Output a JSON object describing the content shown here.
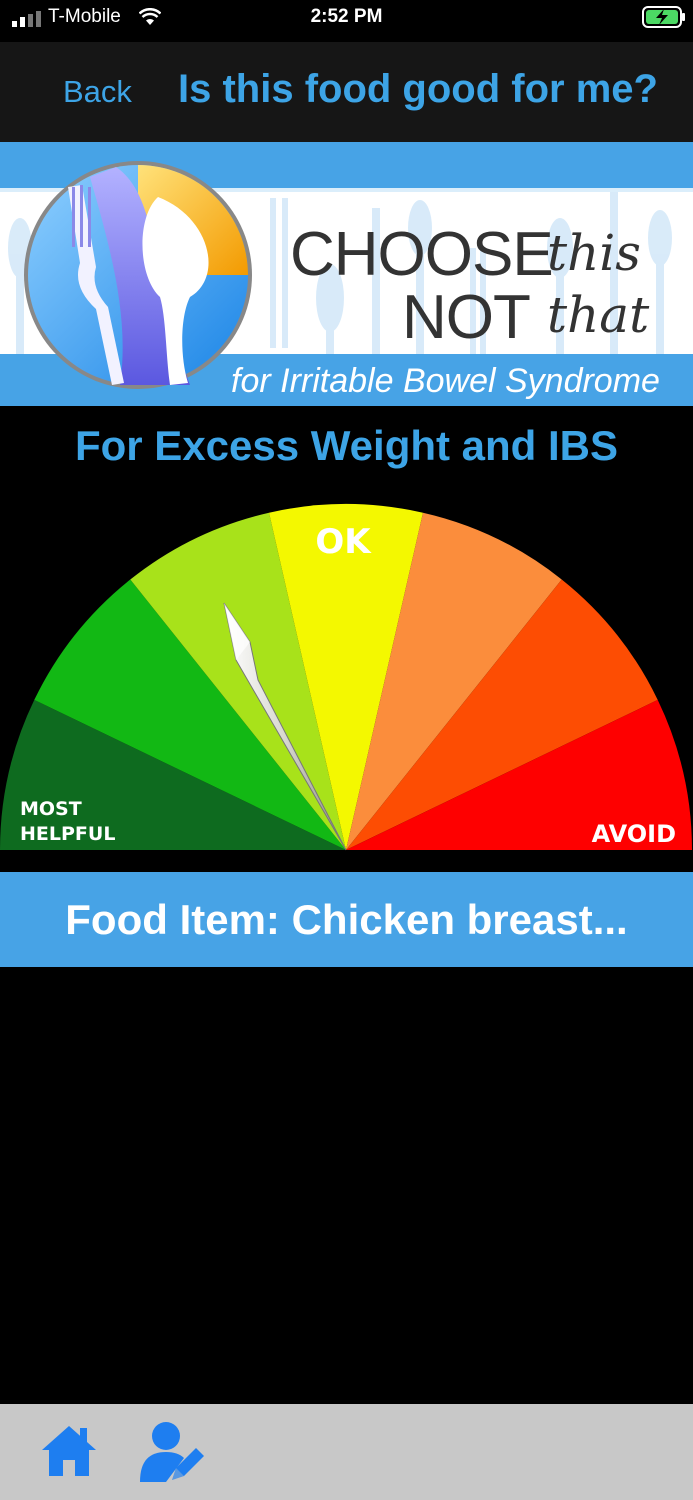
{
  "status_bar": {
    "carrier": "T-Mobile",
    "time": "2:52 PM",
    "icons": [
      "signal-icon",
      "wifi-icon",
      "battery-charging-icon"
    ]
  },
  "nav": {
    "back_label": "Back",
    "title": "Is this food good for me?"
  },
  "banner": {
    "brand_choose": "CHOOSE",
    "brand_this": "this",
    "brand_not": "NOT",
    "brand_that": "that",
    "subtitle": "for Irritable Bowel Syndrome",
    "logo_icon": "fork-spoon-logo"
  },
  "heading": "For Excess Weight and IBS",
  "gauge": {
    "labels": {
      "ok": "OK",
      "most_helpful_line1": "MOST",
      "most_helpful_line2": "HELPFUL",
      "avoid": "AVOID"
    },
    "segment_colors": [
      "#0e6b1f",
      "#12b814",
      "#a8e21a",
      "#f4f800",
      "#fb8d3c",
      "#fd4d03",
      "#fe0000"
    ],
    "needle_segment": "light-green"
  },
  "food_item_label": "Food Item: Chicken breast...",
  "tab_bar": {
    "items": [
      "home-icon",
      "edit-profile-icon"
    ],
    "accent": "#1e7ef0"
  },
  "colors": {
    "accent_blue": "#3da4e6",
    "banner_blue": "#47a3e6"
  }
}
